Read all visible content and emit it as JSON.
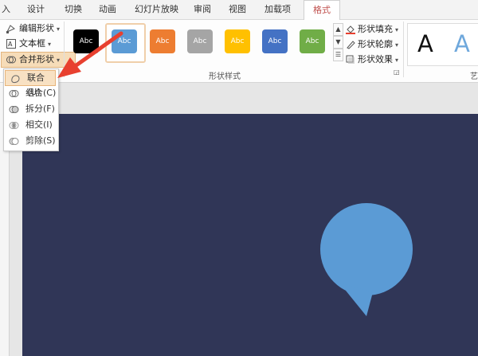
{
  "tabs": {
    "partial": "入",
    "design": "设计",
    "transition": "切换",
    "animation": "动画",
    "slideshow": "幻灯片放映",
    "review": "审阅",
    "view": "视图",
    "addins": "加载项",
    "format": "格式"
  },
  "ribbon": {
    "edit_shape": "编辑形状",
    "text_box": "文本框",
    "merge_shapes": "合并形状",
    "presets_label": "Abc",
    "shape_styles_group": "形状样式",
    "shape_fill": "形状填充",
    "shape_outline": "形状轮廓",
    "shape_effects": "形状效果",
    "wordart_glyph": "A",
    "cut_label": "艺"
  },
  "menu": {
    "union": "联合(U)",
    "combine": "组合(C)",
    "fragment": "拆分(F)",
    "intersect": "相交(I)",
    "subtract": "剪除(S)"
  },
  "colors": {
    "slide_bg": "#303657",
    "shape_fill": "#5b9bd5",
    "arrow": "#e8402f",
    "preset_black": "#000000",
    "preset_blue": "#5b9bd5",
    "preset_orange": "#ed7d31",
    "preset_gray": "#a5a5a5",
    "preset_gold": "#ffc000",
    "preset_darkblue": "#4472c4",
    "preset_green": "#70ad47"
  }
}
